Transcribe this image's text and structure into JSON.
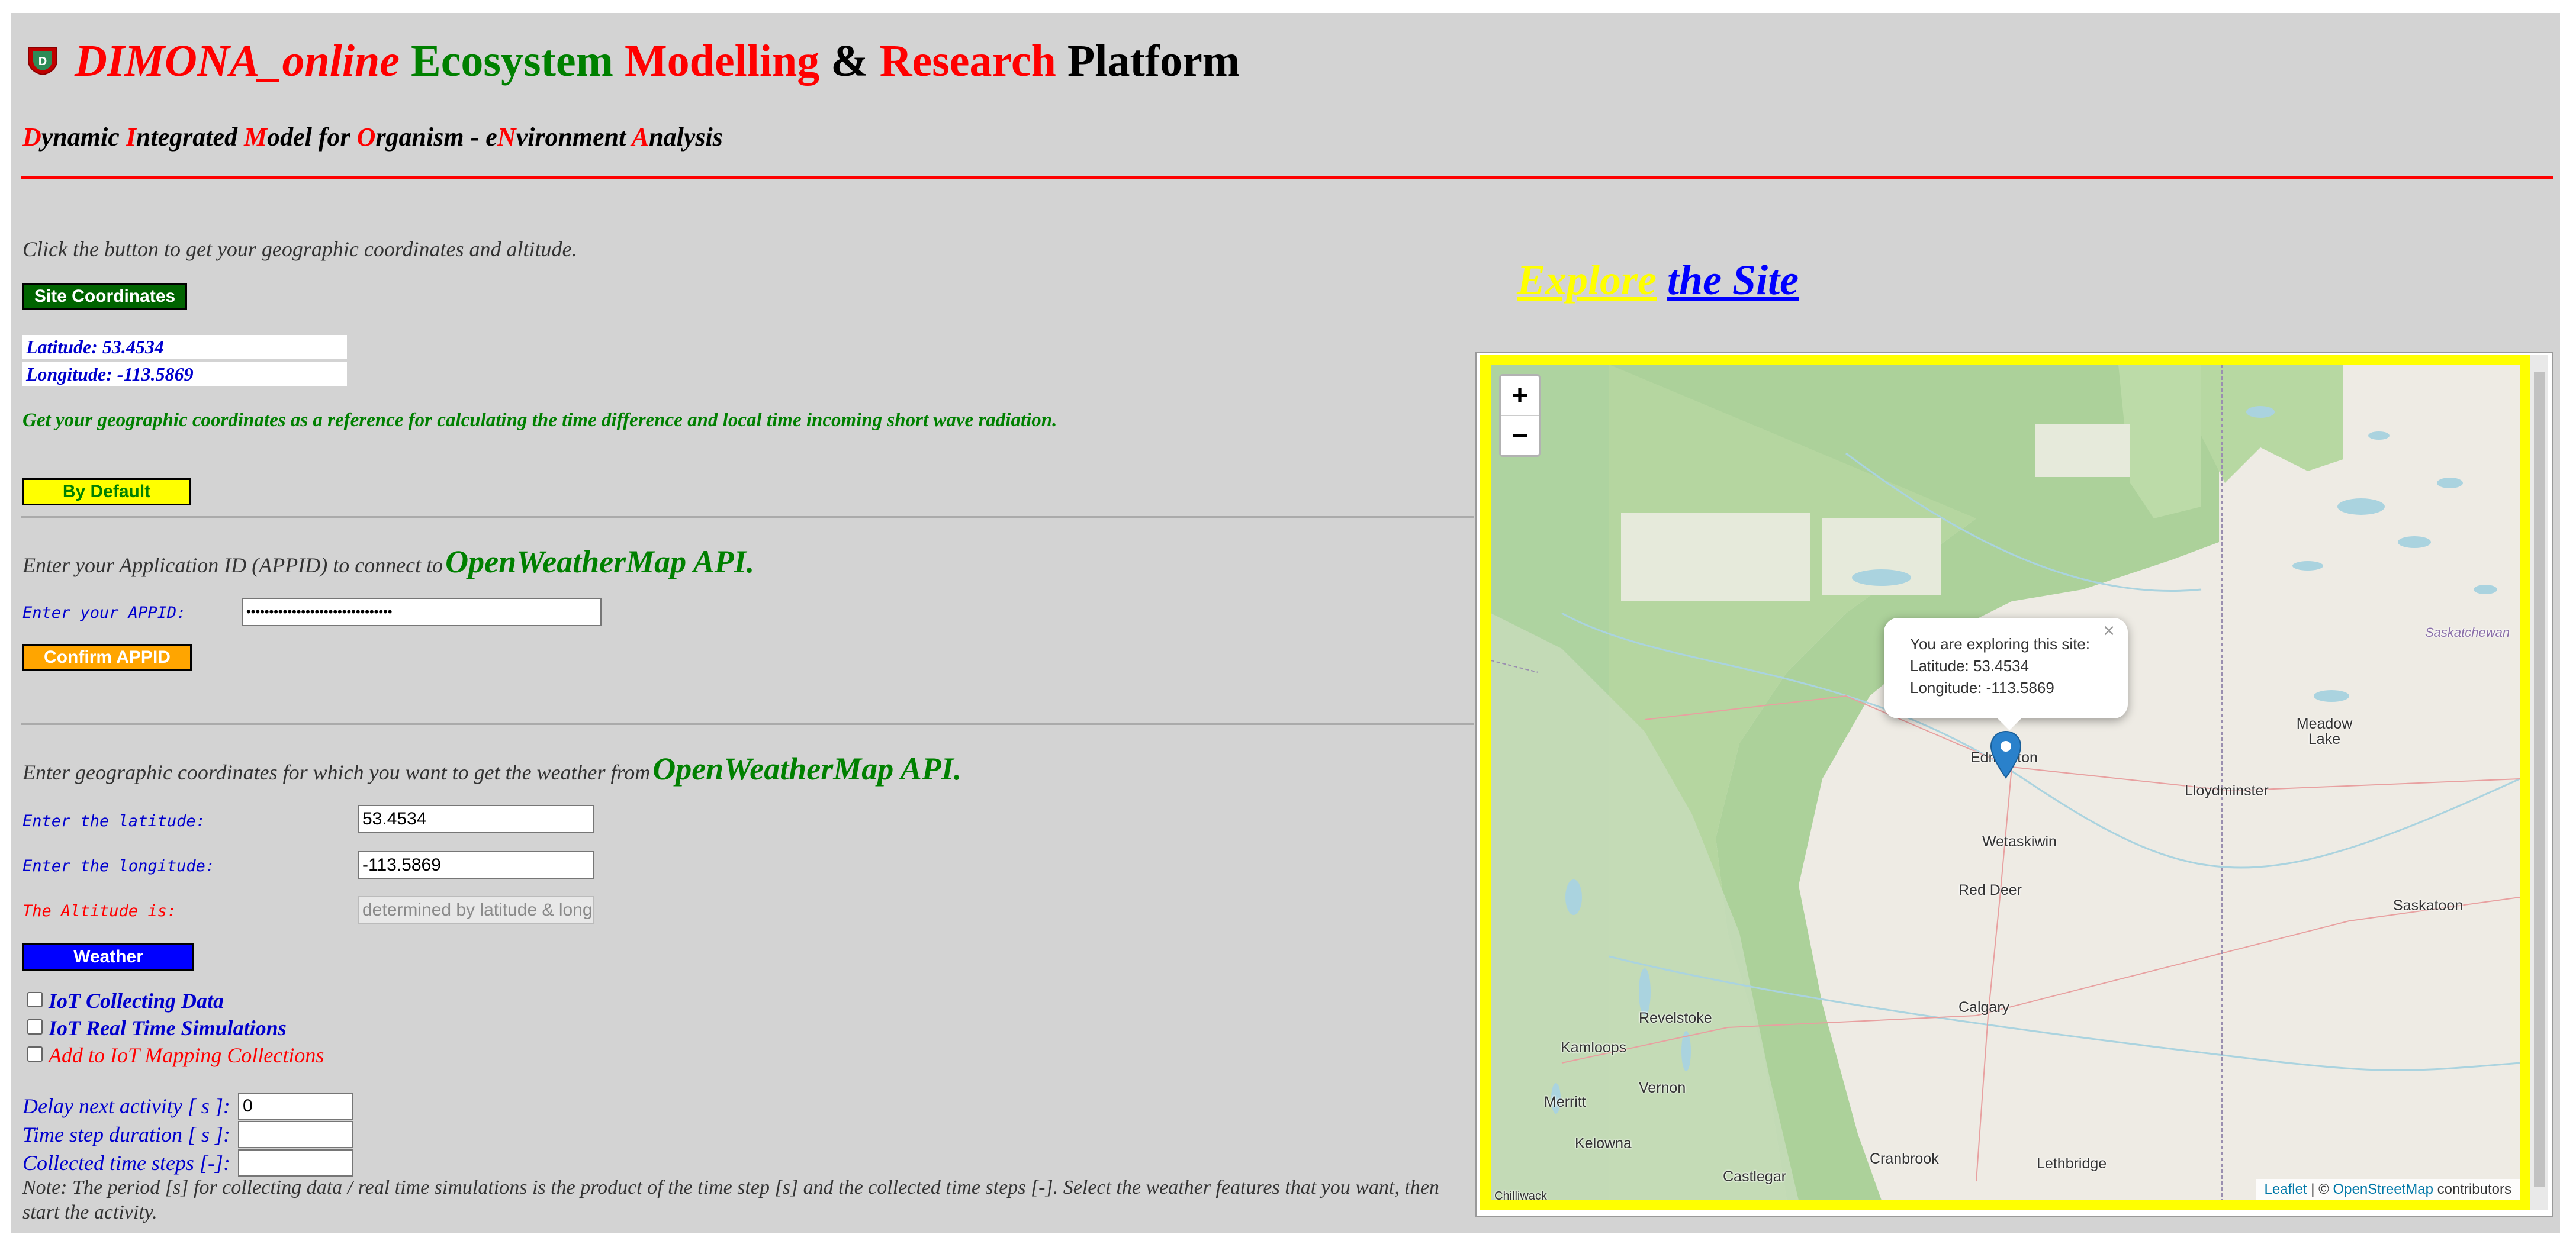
{
  "header": {
    "title_parts": [
      "DIMONA_online",
      "Ecosystem",
      "Modelling",
      "&",
      "Research",
      "Platform"
    ],
    "subtitle_parts": [
      "D",
      "ynamic ",
      "I",
      "ntegrated ",
      "M",
      "odel for ",
      "O",
      "rganism - e",
      "N",
      "vironment ",
      "A",
      "nalysis"
    ]
  },
  "coords_section": {
    "instruction": "Click the button to get your geographic coordinates and altitude.",
    "button_label": "Site Coordinates",
    "latitude_text": "Latitude: 53.4534",
    "longitude_text": "Longitude: -113.5869",
    "note": "Get your geographic coordinates as a reference for calculating the time difference and local time incoming short wave radiation.",
    "default_button_label": "By Default"
  },
  "appid_section": {
    "instruction": "Enter your Application ID (APPID) to connect to",
    "api_name": "OpenWeatherMap API.",
    "label": "Enter your APPID:",
    "value": "••••••••••••••••••••••••••••••••",
    "confirm_label": "Confirm APPID"
  },
  "weather_section": {
    "instruction": "Enter geographic coordinates for which you want to get the weather from",
    "api_name": "OpenWeatherMap API.",
    "lat_label": "Enter the latitude:",
    "lat_value": "53.4534",
    "lon_label": "Enter the longitude:",
    "lon_value": "-113.5869",
    "alt_label": "The Altitude is:",
    "alt_placeholder": "determined by latitude & longitude",
    "weather_button": "Weather"
  },
  "iot": {
    "checkboxes": [
      "IoT Collecting Data",
      "IoT Real Time Simulations",
      "Add to IoT Mapping Collections"
    ],
    "delay_label": "Delay next activity [ s ]:",
    "delay_value": "0",
    "timestep_label": "Time step duration [ s ]:",
    "timestep_value": "",
    "collected_label": "Collected time steps [-]:",
    "collected_value": "",
    "note": "Note: The period [s] for collecting data / real time simulations is the product of the time step [s] and the collected time steps [-]. Select the weather features that you want, then start the activity."
  },
  "map_section": {
    "heading_a": "Explore",
    "heading_b": "the Site",
    "zoom_in": "+",
    "zoom_out": "−",
    "popup_line1": "You are exploring this site:",
    "popup_line2": "Latitude: 53.4534",
    "popup_line3": "Longitude: -113.5869",
    "popup_close": "×",
    "cities": [
      "Edmonton",
      "Lloydminster",
      "Wetaskiwin",
      "Red Deer",
      "Meadow Lake",
      "Saskatoon",
      "Calgary",
      "Revelstoke",
      "Kamloops",
      "Vernon",
      "Merritt",
      "Kelowna",
      "Castlegar",
      "Cranbrook",
      "Lethbridge",
      "Chilliwack",
      "Saskatchewan"
    ],
    "attrib_leaflet": "Leaflet",
    "attrib_sep": " | © ",
    "attrib_osm": "OpenStreetMap",
    "attrib_tail": " contributors"
  },
  "colors": {
    "brand_red": "#ff0000",
    "brand_green": "#008000",
    "link_blue": "#0000cd",
    "map_frame": "#ffff00"
  }
}
